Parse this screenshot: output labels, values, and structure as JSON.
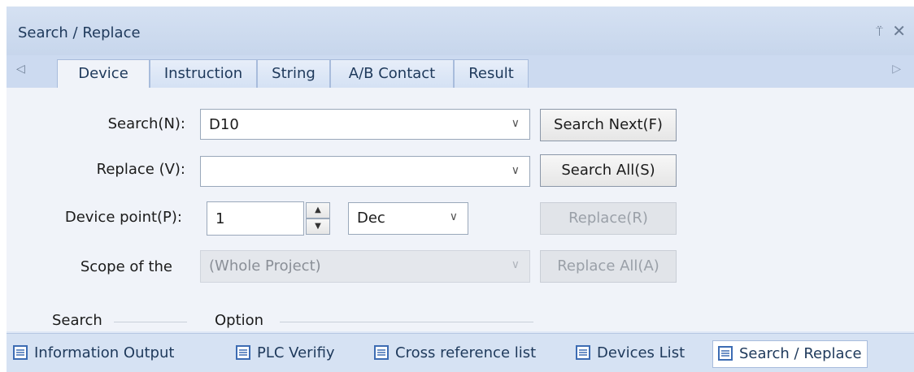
{
  "panel": {
    "title": "Search / Replace",
    "pin_glyph": "⍡",
    "close_glyph": "✕"
  },
  "tabs": {
    "scroll_left": "◁",
    "scroll_right": "▷",
    "items": [
      {
        "label": "Device",
        "active": true
      },
      {
        "label": "Instruction",
        "active": false
      },
      {
        "label": "String",
        "active": false
      },
      {
        "label": "A/B Contact",
        "active": false
      },
      {
        "label": "Result",
        "active": false
      }
    ]
  },
  "form": {
    "search_label": "Search(N):",
    "search_value": "D10",
    "replace_label": "Replace (V):",
    "replace_value": "",
    "device_point_label": "Device point(P):",
    "device_point_value": "1",
    "radix_value": "Dec",
    "scope_label": "Scope of the",
    "scope_value": "(Whole Project)",
    "search_group_label": "Search",
    "option_group_label": "Option",
    "chevron": "∨",
    "spin_up": "▲",
    "spin_down": "▼"
  },
  "buttons": {
    "search_next": "Search Next(F)",
    "search_all": "Search All(S)",
    "replace": "Replace(R)",
    "replace_all": "Replace All(A)"
  },
  "bottom_tabs": [
    {
      "label": "Information Output",
      "active": false
    },
    {
      "label": "PLC Verifiy",
      "active": false
    },
    {
      "label": "Cross reference list",
      "active": false
    },
    {
      "label": "Devices List",
      "active": false
    },
    {
      "label": "Search / Replace",
      "active": true
    }
  ],
  "colors": {
    "accent": "#1e395b",
    "panel_bg": "#f0f3f9",
    "icon_blue": "#3d6cb3"
  }
}
